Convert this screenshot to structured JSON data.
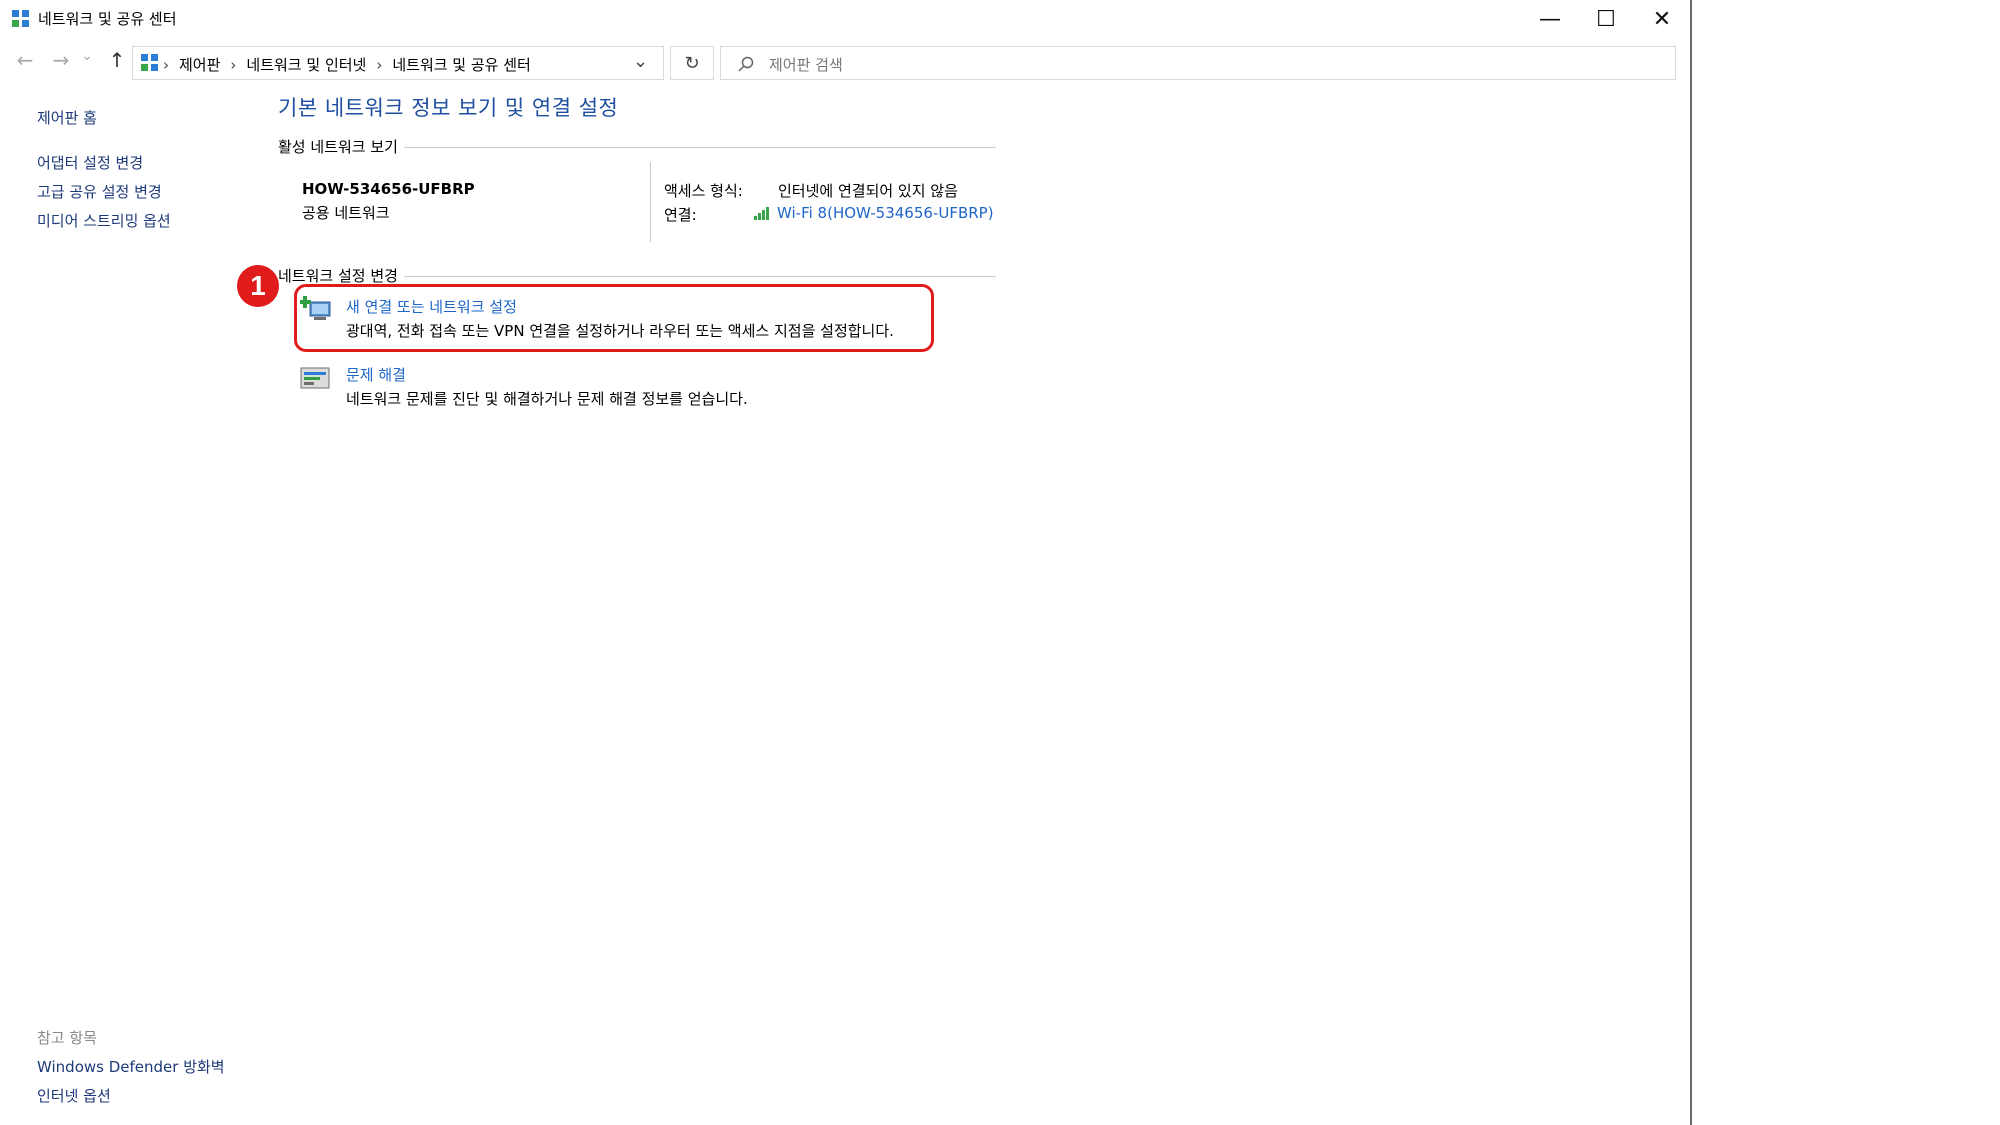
{
  "window": {
    "title": "네트워크 및 공유 센터",
    "minimize_glyph": "—",
    "maximize_glyph": "☐",
    "close_glyph": "✕"
  },
  "nav": {
    "back_glyph": "←",
    "forward_glyph": "→",
    "recent_glyph": "⌄",
    "up_glyph": "↑",
    "breadcrumb_sep": "›",
    "breadcrumbs": [
      "제어판",
      "네트워크 및 인터넷",
      "네트워크 및 공유 센터"
    ],
    "dropdown_glyph": "⌄",
    "refresh_glyph": "↻",
    "search_placeholder": "제어판 검색"
  },
  "sidebar": {
    "home": "제어판 홈",
    "links": [
      "어댑터 설정 변경",
      "고급 공유 설정 변경",
      "미디어 스트리밍 옵션"
    ],
    "see_also_label": "참고 항목",
    "see_also": [
      "Windows Defender 방화벽",
      "인터넷 옵션"
    ]
  },
  "main": {
    "title": "기본 네트워크 정보 보기 및 연결 설정",
    "active_section": "활성 네트워크 보기",
    "network_name": "HOW-534656-UFBRP",
    "network_type": "공용 네트워크",
    "access_label": "액세스 형식:",
    "access_value": "인터넷에 연결되어 있지 않음",
    "connection_label": "연결:",
    "connection_value": "Wi-Fi 8(HOW-534656-UFBRP)",
    "change_section": "네트워크 설정 변경",
    "tasks": [
      {
        "title": "새 연결 또는 네트워크 설정",
        "desc": "광대역, 전화 접속 또는 VPN 연결을 설정하거나 라우터 또는 액세스 지점을 설정합니다."
      },
      {
        "title": "문제 해결",
        "desc": "네트워크 문제를 진단 및 해결하거나 문제 해결 정보를 얻습니다."
      }
    ]
  },
  "annotation": {
    "badge": "1",
    "color": "#e01b1b"
  },
  "colors": {
    "link": "#1e66c8",
    "title": "#1e4fa0",
    "sidebar_link": "#1e3a7a"
  },
  "icons": {
    "window_icon": "network-center-icon",
    "search_icon": "search-icon",
    "wifi_icon": "wifi-signal-icon",
    "new_connection_icon": "new-connection-icon",
    "troubleshoot_icon": "troubleshoot-icon"
  }
}
